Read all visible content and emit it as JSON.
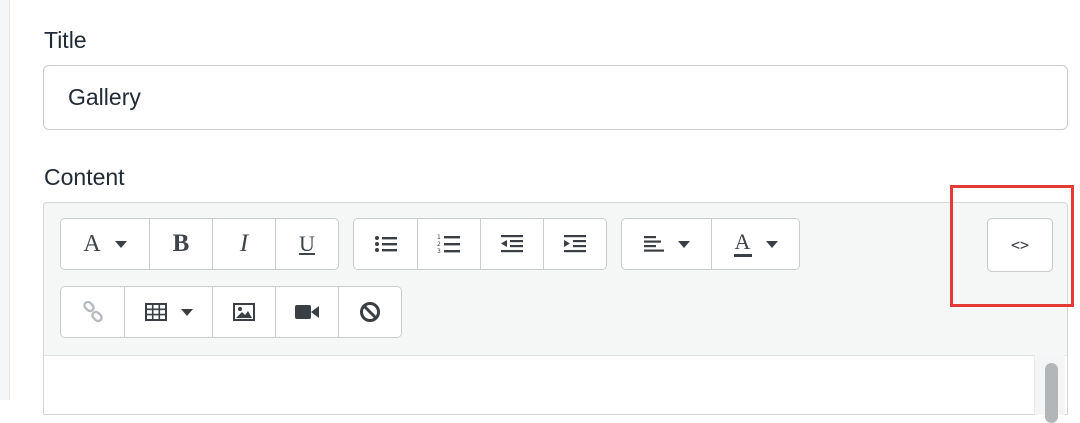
{
  "form": {
    "title_label": "Title",
    "title_value": "Gallery",
    "content_label": "Content"
  },
  "toolbar": {
    "row1": {
      "text_style_glyph": "A",
      "bold_glyph": "B",
      "italic_glyph": "I",
      "underline_glyph": "U",
      "font_color_glyph": "A"
    },
    "html_toggle_label": "<>"
  },
  "colors": {
    "highlight_border": "#e53935",
    "toolbar_background": "#f5f7f6",
    "border": "#c9cccf"
  }
}
